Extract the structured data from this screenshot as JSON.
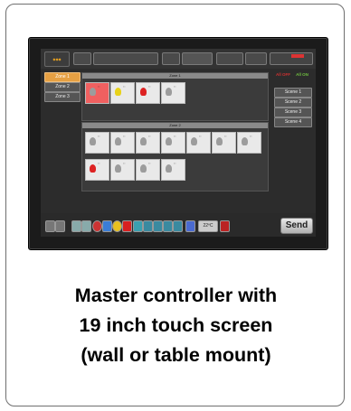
{
  "caption": {
    "line1": "Master controller with",
    "line2": "19 inch touch screen",
    "line3": "(wall or table mount)"
  },
  "screen": {
    "zones": [
      "Zone 1",
      "Zone 2",
      "Zone 3"
    ],
    "scenes": [
      "Scene 1",
      "Scene 2",
      "Scene 3",
      "Scene 4"
    ],
    "all_off": "All OFF",
    "all_on": "All ON",
    "panel_top_title": "Zone 1",
    "panel_bottom_title": "Zone 2",
    "send_label": "Send",
    "temp_label": "22ºC",
    "colors": {
      "active_zone": "#e6a043",
      "all_off": "#d03030",
      "all_on": "#70c040",
      "send_bg": "#cfcfcf"
    }
  }
}
